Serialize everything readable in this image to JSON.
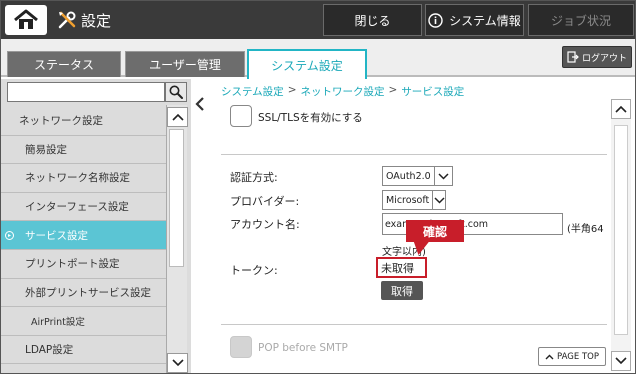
{
  "header": {
    "title": "設定",
    "close_label": "閉じる",
    "sysinfo_label": "システム情報",
    "job_label": "ジョブ状況"
  },
  "tabs": [
    {
      "label": "ステータス",
      "active": false
    },
    {
      "label": "ユーザー管理",
      "active": false
    },
    {
      "label": "システム設定",
      "active": true
    }
  ],
  "logout_label": "ログアウト",
  "search": {
    "value": ""
  },
  "sidebar": {
    "items": [
      {
        "label": "ネットワーク設定"
      },
      {
        "label": "簡易設定"
      },
      {
        "label": "ネットワーク名称設定"
      },
      {
        "label": "インターフェース設定"
      },
      {
        "label": "サービス設定",
        "active": true
      },
      {
        "label": "プリントポート設定"
      },
      {
        "label": "外部プリントサービス設定"
      },
      {
        "label": "AirPrint設定"
      },
      {
        "label": "LDAP設定"
      }
    ]
  },
  "breadcrumb": [
    "システム設定",
    ">",
    "ネットワーク設定",
    ">",
    "サービス設定"
  ],
  "form": {
    "ssl_label": "SSL/TLSを有効にする",
    "auth_label": "認証方式:",
    "auth_value": "OAuth2.0",
    "provider_label": "プロバイダー:",
    "provider_value": "Microsoft",
    "account_label": "アカウント名:",
    "account_value": "exam          nmicrosoft.com",
    "account_note_1": "(半角64",
    "account_note_2": "文字以内)",
    "token_label": "トークン:",
    "token_value": "未取得",
    "get_button": "取得",
    "pop_label": "POP before SMTP"
  },
  "callout": "確認",
  "page_top_label": "PAGE TOP",
  "colors": {
    "accent": "#22b5c5",
    "highlight": "#c81e2a",
    "topbar": "#3a3a3a"
  }
}
